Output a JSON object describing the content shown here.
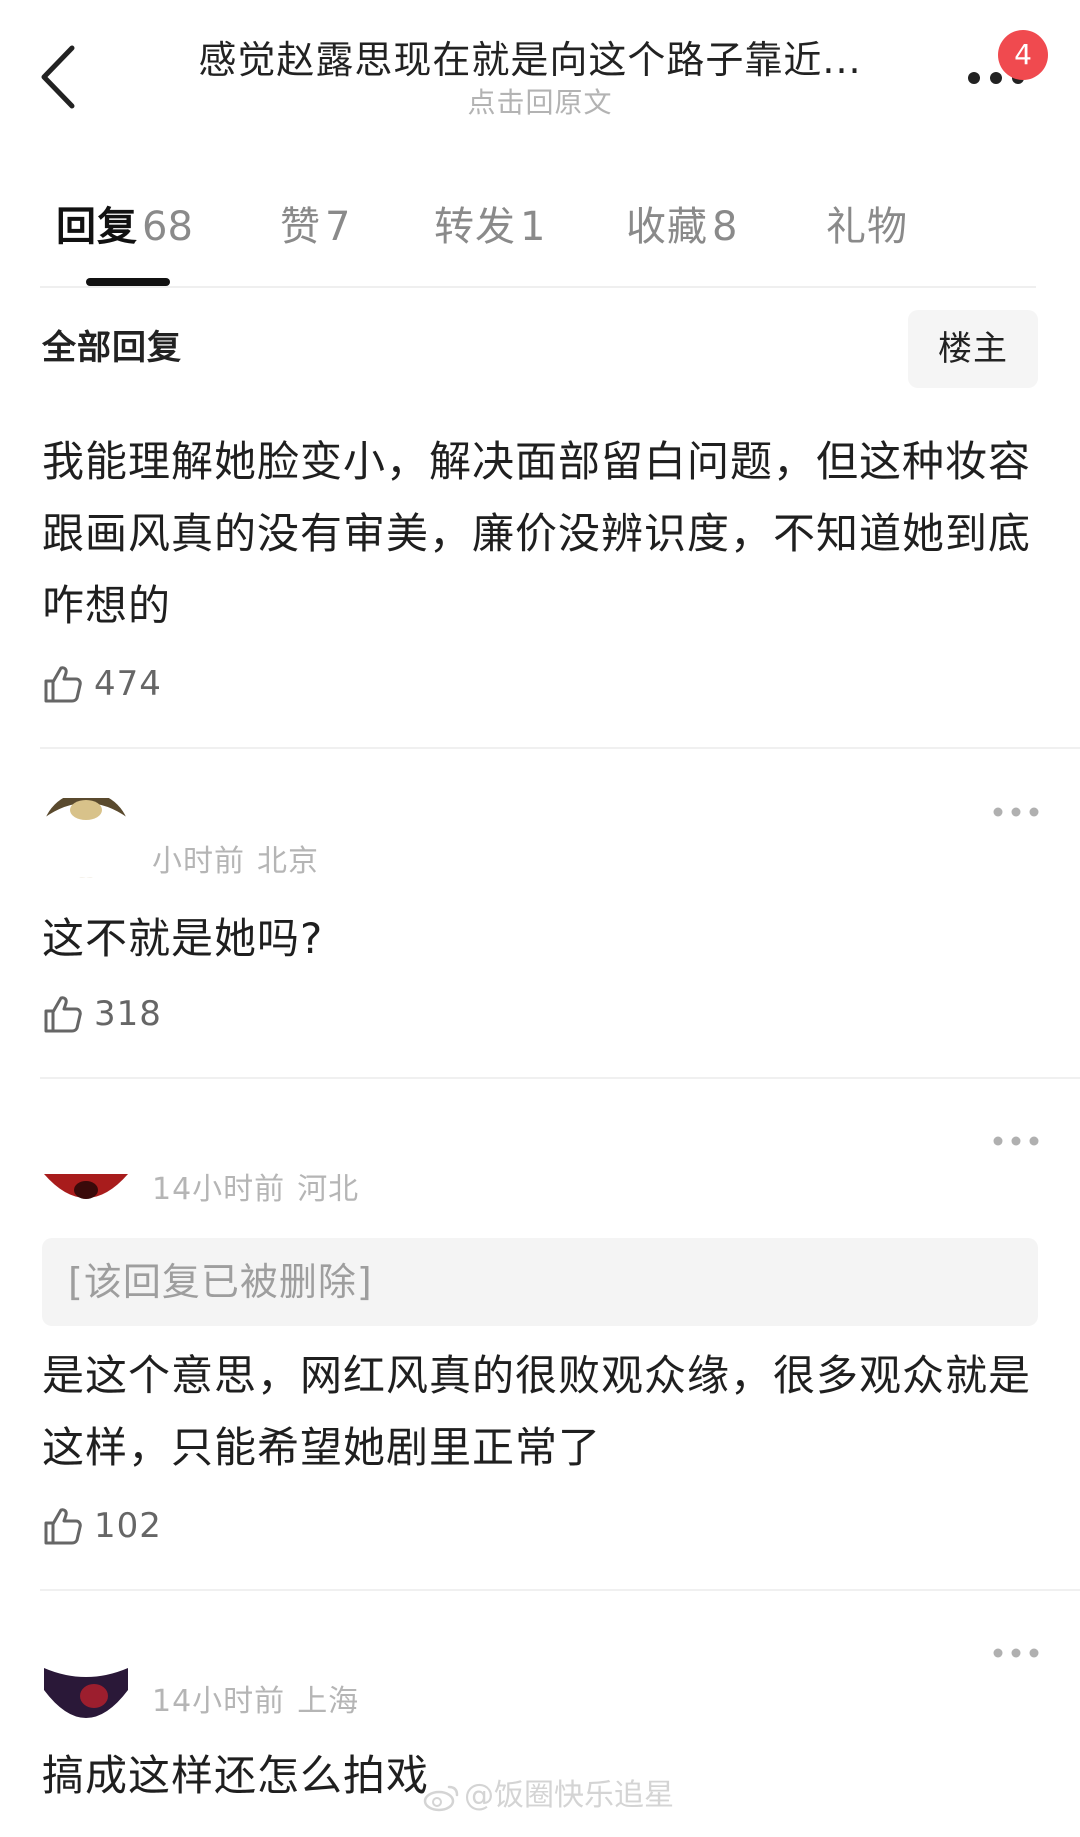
{
  "header": {
    "title": "感觉赵露思现在就是向这个路子靠近...",
    "subtitle": "点击回原文",
    "notification_count": "4"
  },
  "tabs": [
    {
      "label": "回复",
      "count": "68",
      "active": true
    },
    {
      "label": "赞",
      "count": "7",
      "active": false
    },
    {
      "label": "转发",
      "count": "1",
      "active": false
    },
    {
      "label": "收藏",
      "count": "8",
      "active": false
    },
    {
      "label": "礼物",
      "count": "",
      "active": false
    }
  ],
  "filter": {
    "section_label": "全部回复",
    "owner_button": "楼主"
  },
  "comments": [
    {
      "text": "我能理解她脸变小，解决面部留白问题，但这种妆容跟画风真的没有审美，廉价没辨识度，不知道她到底咋想的",
      "likes": "474"
    },
    {
      "meta_time": "小时前",
      "meta_location": "北京",
      "text": "这不就是她吗?",
      "likes": "318"
    },
    {
      "meta_time": "14小时前",
      "meta_location": "河北",
      "deleted_notice": "[该回复已被删除]",
      "text": "是这个意思，网红风真的很败观众缘，很多观众就是这样，只能希望她剧里正常了",
      "likes": "102"
    },
    {
      "meta_time": "14小时前",
      "meta_location": "上海",
      "text": "搞成这样还怎么拍戏"
    }
  ],
  "watermark": "@饭圈快乐追星",
  "colors": {
    "badge": "#f04a4f",
    "text_primary": "#1f1f1f",
    "text_muted": "#8a8a8a",
    "meta": "#b5b5b5"
  },
  "icons": {
    "back": "chevron-left-icon",
    "more": "more-dots-icon",
    "like": "thumbs-up-icon",
    "watermark": "weibo-icon"
  }
}
